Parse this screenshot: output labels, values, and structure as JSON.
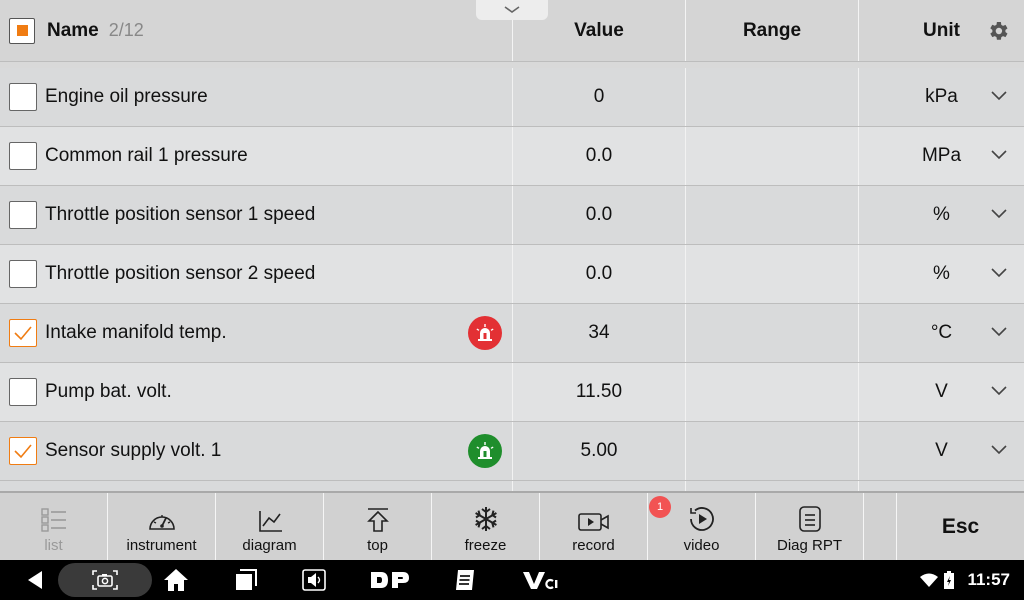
{
  "header": {
    "name_label": "Name",
    "count": "2/12",
    "value_label": "Value",
    "range_label": "Range",
    "unit_label": "Unit"
  },
  "rows": [
    {
      "name": "Engine oil pressure",
      "value": "0",
      "range": "",
      "unit": "kPa",
      "checked": false,
      "alarm": null
    },
    {
      "name": "Common rail 1 pressure",
      "value": "0.0",
      "range": "",
      "unit": "MPa",
      "checked": false,
      "alarm": null
    },
    {
      "name": "Throttle position sensor 1 speed",
      "value": "0.0",
      "range": "",
      "unit": "%",
      "checked": false,
      "alarm": null
    },
    {
      "name": "Throttle position sensor 2 speed",
      "value": "0.0",
      "range": "",
      "unit": "%",
      "checked": false,
      "alarm": null
    },
    {
      "name": "Intake manifold temp.",
      "value": "34",
      "range": "",
      "unit": "°C",
      "checked": true,
      "alarm": "red"
    },
    {
      "name": "Pump bat. volt.",
      "value": "11.50",
      "range": "",
      "unit": "V",
      "checked": false,
      "alarm": null
    },
    {
      "name": "Sensor supply volt. 1",
      "value": "5.00",
      "range": "",
      "unit": "V",
      "checked": true,
      "alarm": "green"
    }
  ],
  "toolbar": {
    "list": "list",
    "instrument": "instrument",
    "diagram": "diagram",
    "top": "top",
    "freeze": "freeze",
    "record": "record",
    "video": "video",
    "video_badge": "1",
    "diag_rpt": "Diag RPT",
    "esc": "Esc"
  },
  "statusbar": {
    "time": "11:57"
  },
  "colors": {
    "accent": "#f07c12",
    "alarm_red": "#e33034",
    "alarm_green": "#1f8e2c",
    "badge": "#f25353"
  }
}
